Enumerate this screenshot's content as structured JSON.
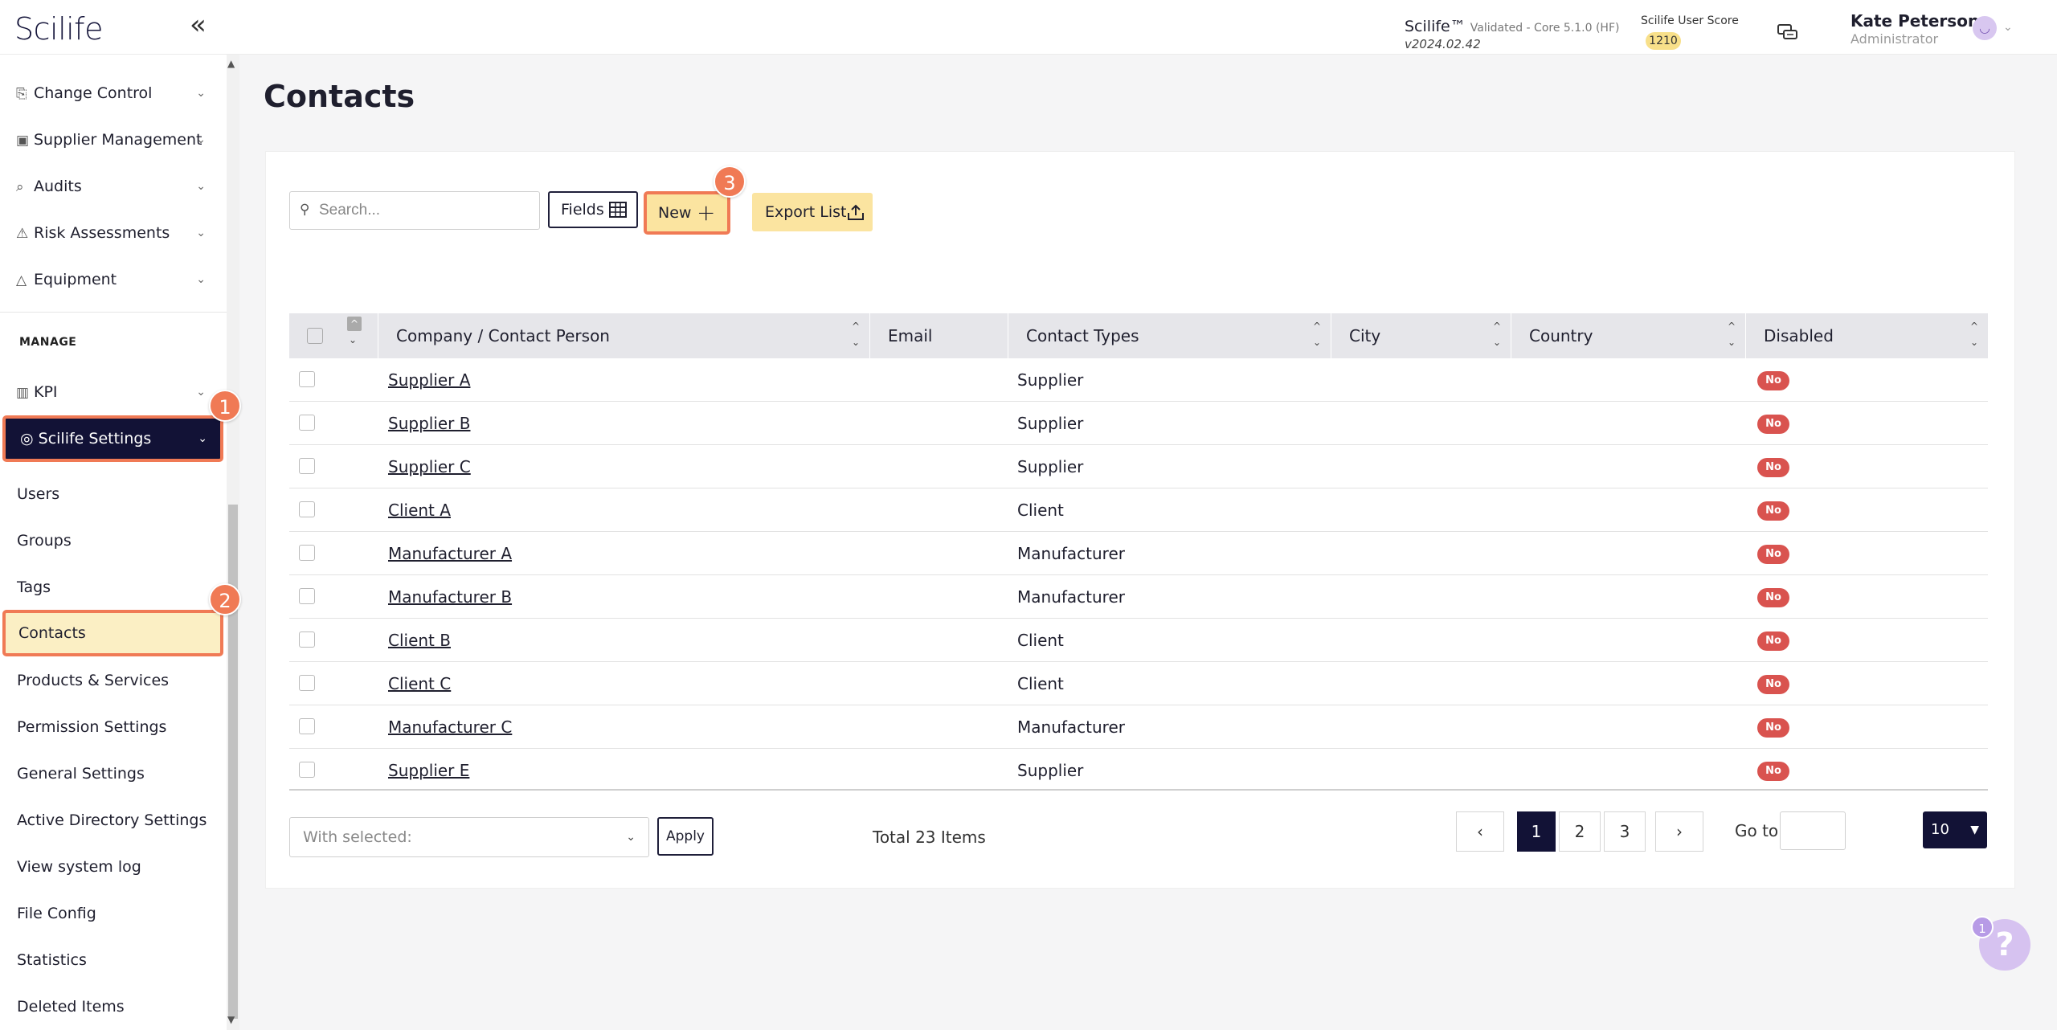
{
  "header": {
    "logo": "Scilife",
    "collapse_icon": "«",
    "version_title": "Scilife™",
    "version_sub": "Validated - Core 5.1.0 (HF)",
    "version": "v2024.02.42",
    "score_label": "Scilife User Score",
    "score": "1210",
    "user_name": "Kate Peterson",
    "user_role": "Administrator"
  },
  "sidebar": {
    "modules": [
      {
        "label": "Change Control",
        "icon": "change-control-icon"
      },
      {
        "label": "Supplier Management",
        "icon": "supplier-icon"
      },
      {
        "label": "Audits",
        "icon": "audit-icon"
      },
      {
        "label": "Risk Assessments",
        "icon": "warning-icon"
      },
      {
        "label": "Equipment",
        "icon": "flask-icon"
      }
    ],
    "section_label": "MANAGE",
    "kpi_label": "KPI",
    "settings_label": "Scilife Settings",
    "sub_items": [
      "Users",
      "Groups",
      "Tags",
      "Contacts",
      "Products & Services",
      "Permission Settings",
      "General Settings",
      "Active Directory Settings",
      "View system log",
      "File Config",
      "Statistics",
      "Deleted Items"
    ]
  },
  "steps": [
    "1",
    "2",
    "3"
  ],
  "main": {
    "title": "Contacts",
    "search_placeholder": "Search...",
    "fields_label": "Fields",
    "new_label": "New",
    "export_label": "Export List",
    "columns": [
      "Company / Contact Person",
      "Email",
      "Contact Types",
      "City",
      "Country",
      "Disabled"
    ],
    "rows": [
      {
        "name": "Supplier A",
        "type": "Supplier",
        "disabled": "No"
      },
      {
        "name": "Supplier B",
        "type": "Supplier",
        "disabled": "No"
      },
      {
        "name": "Supplier C",
        "type": "Supplier",
        "disabled": "No"
      },
      {
        "name": "Client A",
        "type": "Client",
        "disabled": "No"
      },
      {
        "name": "Manufacturer A",
        "type": "Manufacturer",
        "disabled": "No"
      },
      {
        "name": "Manufacturer B",
        "type": "Manufacturer",
        "disabled": "No"
      },
      {
        "name": "Client B",
        "type": "Client",
        "disabled": "No"
      },
      {
        "name": "Client C",
        "type": "Client",
        "disabled": "No"
      },
      {
        "name": "Manufacturer C",
        "type": "Manufacturer",
        "disabled": "No"
      },
      {
        "name": "Supplier E",
        "type": "Supplier",
        "disabled": "No"
      }
    ],
    "bulk_placeholder": "With selected:",
    "apply_label": "Apply",
    "total": "Total 23 Items",
    "pages": [
      "1",
      "2",
      "3"
    ],
    "goto_label": "Go to",
    "page_size": "10",
    "help_count": "1"
  }
}
